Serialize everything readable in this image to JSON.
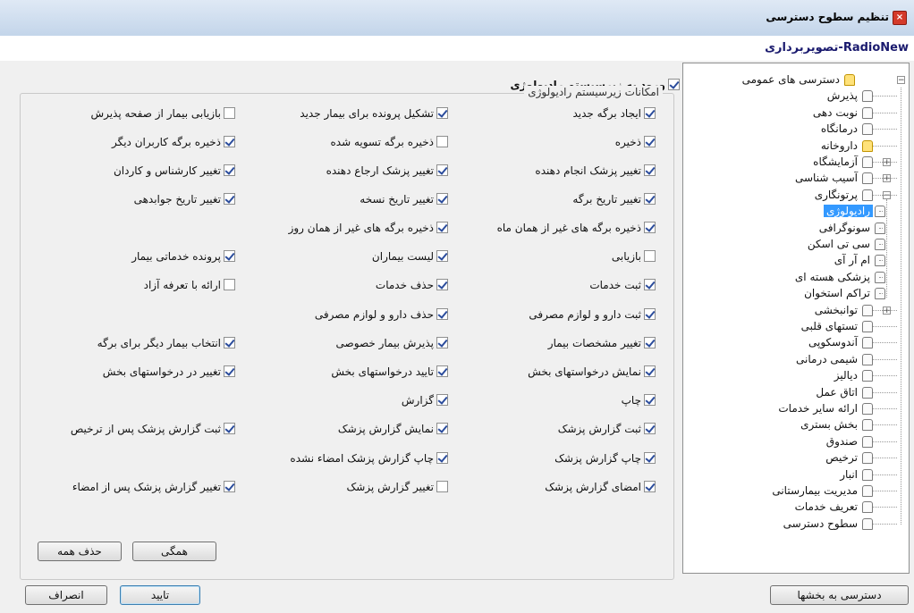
{
  "window": {
    "title": "تنظیم سطوح دسترسی",
    "subtitle": "RadioNew-تصویربرداری"
  },
  "tree": {
    "items": [
      {
        "label": "دسترسی های عمومی",
        "level": 0,
        "expander": "minus",
        "icon": "key"
      },
      {
        "label": "پذیرش",
        "level": 1
      },
      {
        "label": "نوبت دهی",
        "level": 1
      },
      {
        "label": "درمانگاه",
        "level": 1
      },
      {
        "label": "داروخانه",
        "level": 1,
        "icon": "key"
      },
      {
        "label": "آزمایشگاه",
        "level": 1,
        "expander": "plus"
      },
      {
        "label": "آسیب شناسی",
        "level": 1,
        "expander": "plus"
      },
      {
        "label": "پرتونگاری",
        "level": 1,
        "expander": "minus"
      },
      {
        "label": "رادیولوژی",
        "level": 2,
        "selected": true
      },
      {
        "label": "سونوگرافی",
        "level": 2
      },
      {
        "label": "سی تی اسکن",
        "level": 2
      },
      {
        "label": "ام آر آی",
        "level": 2
      },
      {
        "label": "پزشکی هسته ای",
        "level": 2
      },
      {
        "label": "تراکم استخوان",
        "level": 2
      },
      {
        "label": "توانبخشی",
        "level": 1,
        "expander": "plus"
      },
      {
        "label": "تستهای قلبی",
        "level": 1
      },
      {
        "label": "آندوسکوپی",
        "level": 1
      },
      {
        "label": "شیمی درمانی",
        "level": 1
      },
      {
        "label": "دیالیز",
        "level": 1
      },
      {
        "label": "اتاق عمل",
        "level": 1
      },
      {
        "label": "ارائه سایر خدمات",
        "level": 1
      },
      {
        "label": "بخش بستری",
        "level": 1
      },
      {
        "label": "صندوق",
        "level": 1
      },
      {
        "label": "ترخیص",
        "level": 1
      },
      {
        "label": "انبار",
        "level": 1
      },
      {
        "label": "مدیریت بیمارستانی",
        "level": 1
      },
      {
        "label": "تعریف خدمات",
        "level": 1
      },
      {
        "label": "سطوح دسترسی",
        "level": 1
      }
    ]
  },
  "main_checkbox": {
    "label": "ورود به زیرسیستم رادیولوژی",
    "checked": true
  },
  "group": {
    "legend": "امکانات زیرسیستم رادیولوژی",
    "rows": [
      [
        {
          "label": "ایجاد برگه جدید",
          "checked": true
        },
        {
          "label": "تشکیل پرونده برای بیمار جدید",
          "checked": true
        },
        {
          "label": "بازیابی بیمار  از صفحه پذیرش",
          "checked": false
        }
      ],
      [
        {
          "label": "ذخیره",
          "checked": true
        },
        {
          "label": "ذخیره برگه تسویه شده",
          "checked": false
        },
        {
          "label": "ذخیره برگه کاربران دیگر",
          "checked": true
        }
      ],
      [
        {
          "label": "تغییر پزشک انجام دهنده",
          "checked": true
        },
        {
          "label": "تغییر پزشک ارجاع دهنده",
          "checked": true
        },
        {
          "label": "تغییر کارشناس و کاردان",
          "checked": true
        }
      ],
      [
        {
          "label": "تغییر تاریخ برگه",
          "checked": true
        },
        {
          "label": "تغییر تاریخ نسخه",
          "checked": true
        },
        {
          "label": "تغییر تاریخ جوابدهی",
          "checked": true
        }
      ],
      [
        {
          "label": "ذخیره برگه های غیر از همان ماه",
          "checked": true
        },
        {
          "label": "ذخیره برگه های غیر از همان روز",
          "checked": true
        },
        null
      ],
      [
        {
          "label": "بازیابی",
          "checked": false
        },
        {
          "label": "لیست بیماران",
          "checked": true
        },
        {
          "label": "پرونده خدماتی بیمار",
          "checked": true
        }
      ],
      [
        {
          "label": "ثبت خدمات",
          "checked": true
        },
        {
          "label": "حذف خدمات",
          "checked": true
        },
        {
          "label": "ارائه با تعرفه آزاد",
          "checked": false
        }
      ],
      [
        {
          "label": "ثبت دارو و لوازم مصرفی",
          "checked": true
        },
        {
          "label": "حذف دارو و لوازم مصرفی",
          "checked": true
        },
        null
      ],
      [
        {
          "label": "تغییر مشخصات بیمار",
          "checked": true
        },
        {
          "label": "پذیرش بیمار خصوصی",
          "checked": true
        },
        {
          "label": "انتخاب بیمار دیگر برای برگه",
          "checked": true
        }
      ],
      [
        {
          "label": "نمایش درخواستهای بخش",
          "checked": true
        },
        {
          "label": "تایید درخواستهای بخش",
          "checked": true
        },
        {
          "label": "تغییر در درخواستهای بخش",
          "checked": true
        }
      ],
      [
        {
          "label": "چاپ",
          "checked": true
        },
        {
          "label": "گزارش",
          "checked": true
        },
        null
      ],
      [
        {
          "label": "ثبت گزارش پزشک",
          "checked": true
        },
        {
          "label": "نمایش گزارش پزشک",
          "checked": true
        },
        {
          "label": "ثبت گزارش پزشک پس از ترخیص",
          "checked": true
        }
      ],
      [
        {
          "label": "چاپ گزارش پزشک",
          "checked": true
        },
        {
          "label": "چاپ گزارش پزشک امضاء نشده",
          "checked": true
        },
        null
      ],
      [
        {
          "label": "امضای گزارش پزشک",
          "checked": true
        },
        {
          "label": "تغییر گزارش پزشک",
          "checked": false
        },
        {
          "label": "تغییر گزارش پزشک پس از امضاء",
          "checked": true
        }
      ]
    ]
  },
  "buttons": {
    "select_all": "همگی",
    "clear_all": "حذف همه",
    "confirm": "تایید",
    "cancel": "انصراف",
    "section_access": "دسترسی به بخشها"
  }
}
